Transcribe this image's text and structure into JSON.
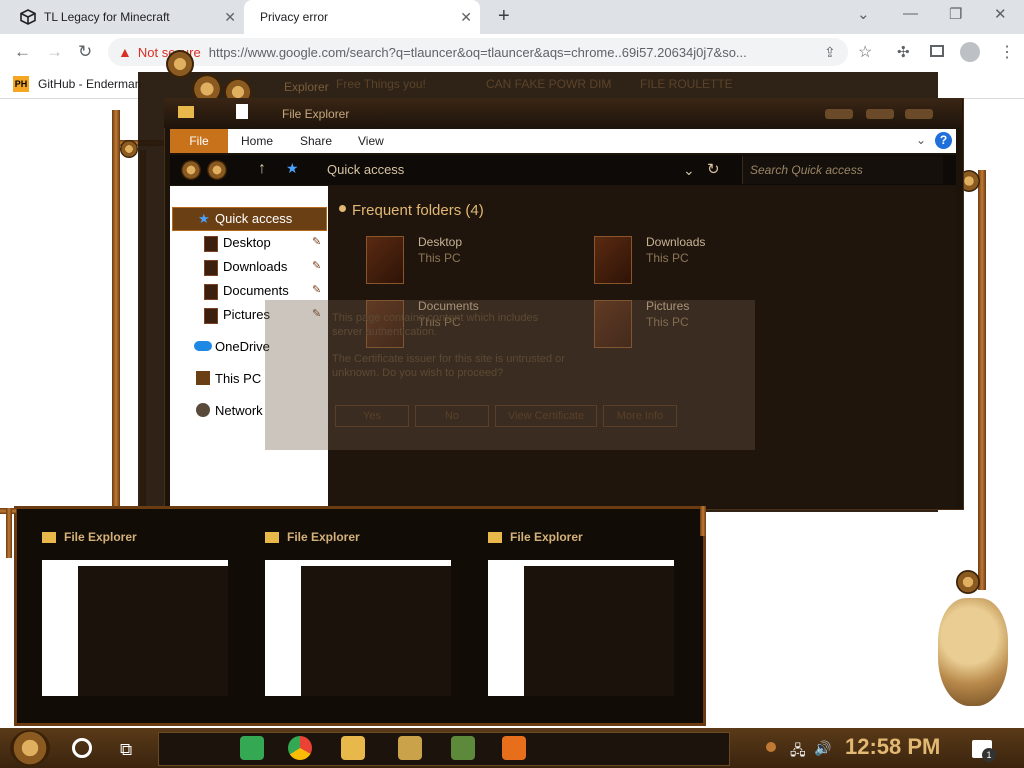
{
  "browser": {
    "tabs": [
      {
        "title": "TL Legacy for Minecraft"
      },
      {
        "title": "Privacy error"
      }
    ],
    "address": {
      "warning": "Not secure",
      "url": "https://www.google.com/search?q=tlauncer&oq=tlauncer&aqs=chrome..69i57.20634j0j7&so..."
    },
    "bookmarks": [
      {
        "icon": "PH",
        "label": "GitHub - Enderman"
      }
    ]
  },
  "background_window": {
    "title": "Explorer",
    "tabs": [
      "Free Things you!",
      "CAN FAKE POWR DIM",
      "FILE ROULETTE"
    ]
  },
  "file_explorer": {
    "title": "File Explorer",
    "ribbon_tabs": [
      "File",
      "Home",
      "Share",
      "View"
    ],
    "location": "Quick access",
    "search_placeholder": "Search Quick access",
    "nav_items": [
      {
        "label": "Quick access"
      },
      {
        "label": "Desktop"
      },
      {
        "label": "Downloads"
      },
      {
        "label": "Documents"
      },
      {
        "label": "Pictures"
      },
      {
        "label": "OneDrive"
      },
      {
        "label": "This PC"
      },
      {
        "label": "Network"
      }
    ],
    "section_title": "Frequent folders (4)",
    "folders": [
      {
        "name": "Desktop",
        "location": "This PC"
      },
      {
        "name": "Downloads",
        "location": "This PC"
      },
      {
        "name": "Documents",
        "location": "This PC"
      },
      {
        "name": "Pictures",
        "location": "This PC"
      }
    ]
  },
  "cert_dialog": {
    "line1": "This page contains content which includes",
    "line2": "server authentication.",
    "line3": "The Certificate issuer for this site is untrusted or",
    "line4": "unknown.  Do you wish to proceed?",
    "buttons": [
      "Yes",
      "No",
      "View Certificate",
      "More Info"
    ]
  },
  "thumbnails": [
    {
      "title": "File Explorer"
    },
    {
      "title": "File Explorer"
    },
    {
      "title": "File Explorer"
    }
  ],
  "taskbar": {
    "time": "12:58 PM",
    "notification_count": "1",
    "pinned_icons": [
      "google-chat-icon",
      "chrome-icon",
      "file-explorer-icon",
      "lucky-patcher-icon",
      "minecraft-icon",
      "java-icon"
    ]
  }
}
